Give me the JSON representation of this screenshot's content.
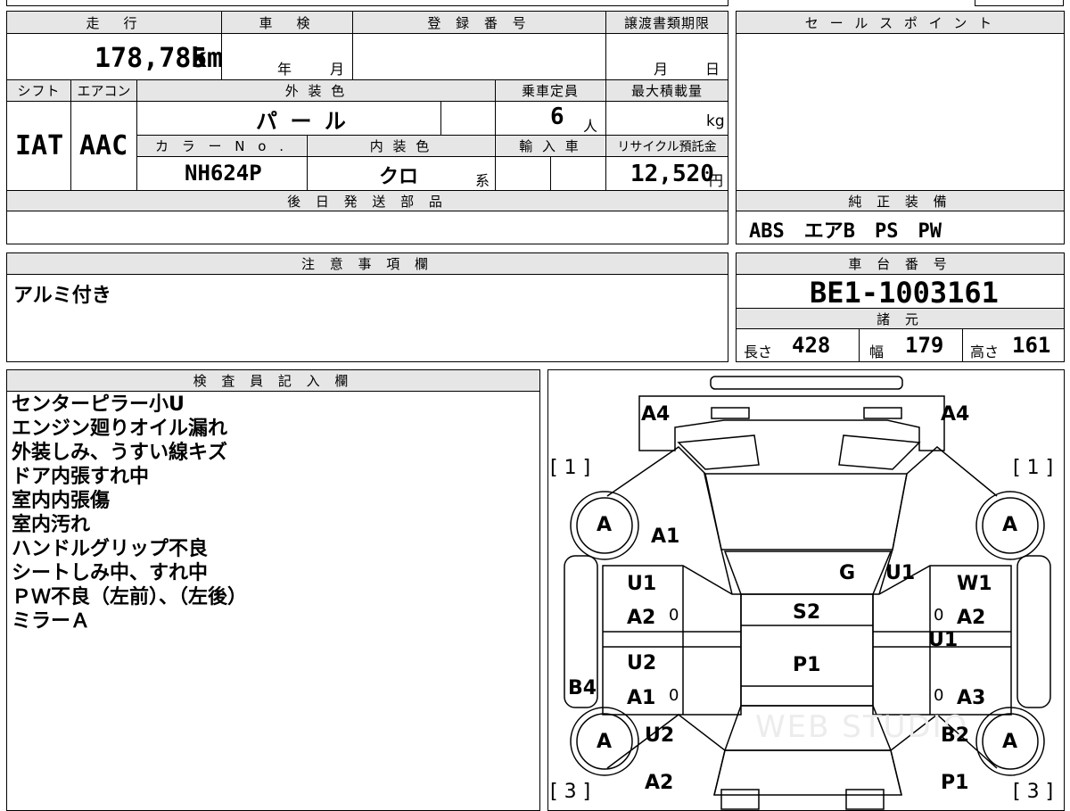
{
  "top_header": {
    "mileage_label": "走　行",
    "shaken_label": "車　検",
    "reg_no_label": "登 録 番 号",
    "transfer_deadline_label": "譲渡書類期限",
    "sale_points_label": "セ ー ル ス ポ イ ン ト"
  },
  "mileage": {
    "value": "178,785",
    "unit": "km"
  },
  "shaken": {
    "year_unit": "年",
    "month_unit": "月"
  },
  "transfer_deadline": {
    "month_unit": "月",
    "day_unit": "日"
  },
  "row2_labels": {
    "shift": "シフト",
    "aircon": "エアコン",
    "exterior_color": "外 装 色",
    "capacity": "乗車定員",
    "max_load": "最大積載量"
  },
  "shift": "IAT",
  "aircon": "AAC",
  "exterior_color": "パ ー ル",
  "capacity": {
    "value": "6",
    "unit": "人"
  },
  "max_load": {
    "unit": "kg"
  },
  "row3_labels": {
    "color_no": "カ ラ ー  N o .",
    "interior_color": "内 装 色",
    "import": "輸 入 車",
    "recycle_fee": "リサイクル預託金"
  },
  "color_no": "NH624P",
  "interior_color": {
    "value": "クロ",
    "suffix": "系"
  },
  "recycle_fee": {
    "value": "12,520",
    "unit": "円"
  },
  "later_parts_label": "後 日 発 送 部 品",
  "standard_equipment": {
    "label": "純 正 装 備",
    "value": "ABS　エアB　PS　PW"
  },
  "caution": {
    "label": "注 意 事 項 欄",
    "value": "アルミ付き"
  },
  "chassis": {
    "label": "車 台 番 号",
    "value": "BE1-1003161"
  },
  "specs": {
    "label": "諸 元",
    "length_label": "長さ",
    "length": "428",
    "width_label": "幅",
    "width": "179",
    "height_label": "高さ",
    "height": "161"
  },
  "inspector": {
    "label": "検 査 員 記 入 欄",
    "lines": [
      "センターピラー小U",
      "エンジン廻りオイル漏れ",
      "外装しみ、うすい線キズ",
      "ドア内張すれ中",
      "室内内張傷",
      "室内汚れ",
      "ハンドルグリップ不良",
      "シートしみ中、すれ中",
      "ＰＷ不良（左前）、（左後）",
      "ミラーＡ"
    ]
  },
  "diagram": {
    "labels": {
      "a4_left": "A4",
      "a4_right": "A4",
      "bracket_1_left": "[ 1 ]",
      "bracket_1_right": "[ 1 ]",
      "wheel_fl": "A",
      "wheel_fr": "A",
      "wheel_rl": "A",
      "wheel_rr": "A",
      "a1_hood": "A1",
      "g_windshield": "G",
      "u1_pillar": "U1",
      "u1_fl": "U1",
      "a2_fl": "A2",
      "w1_fr": "W1",
      "a2_fr": "A2",
      "u1_fr": "U1",
      "s2_roof": "S2",
      "p1_roof": "P1",
      "u2_rl": "U2",
      "a1_rl": "A1",
      "a3_rr": "A3",
      "b4_left": "B4",
      "u2_rear": "U2",
      "b2_rear": "B2",
      "a2_rear": "A2",
      "p1_rear": "P1",
      "bracket_3_left": "[ 3 ]",
      "bracket_3_right": "[ 3 ]",
      "zero_1": "0",
      "zero_2": "0",
      "zero_3": "0",
      "zero_4": "0"
    },
    "watermark": "WEB STUDIO"
  }
}
